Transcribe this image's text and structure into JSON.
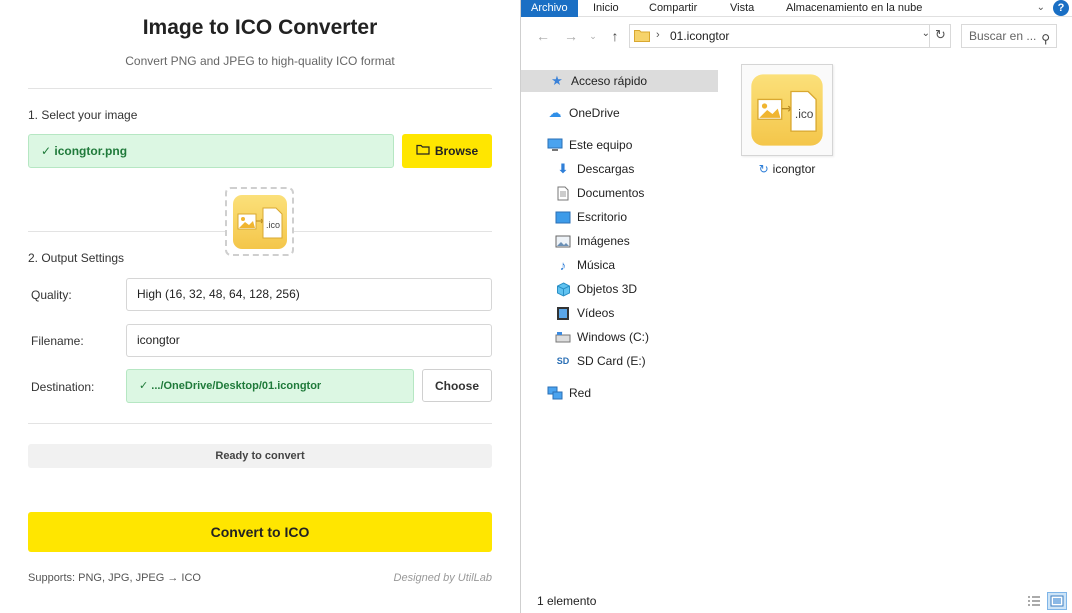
{
  "converter": {
    "title": "Image to ICO Converter",
    "subtitle": "Convert PNG and JPEG to high-quality ICO format",
    "step1_label": "1. Select your image",
    "selected_file": "✓ icongtor.png",
    "browse_label": "Browse",
    "step2_label": "2. Output Settings",
    "quality_label": "Quality:",
    "quality_value": "High (16, 32, 48, 64, 128, 256)",
    "filename_label": "Filename:",
    "filename_value": "icongtor",
    "destination_label": "Destination:",
    "destination_value": "✓ .../OneDrive/Desktop/01.icongtor",
    "choose_label": "Choose",
    "status": "Ready to convert",
    "convert_label": "Convert to ICO",
    "supports": "Supports: PNG, JPG, JPEG → ICO",
    "credit": "Designed by UtilLab",
    "accent_color": "#ffe600",
    "success_color": "#dcf7e3"
  },
  "explorer": {
    "ribbon_tabs": [
      "Archivo",
      "Inicio",
      "Compartir",
      "Vista",
      "Almacenamiento en la nube"
    ],
    "help": "?",
    "address_path": "01.icongtor",
    "search_placeholder": "Buscar en ...",
    "nav_items": [
      {
        "label": "Acceso rápido",
        "icon": "star-icon"
      },
      {
        "label": "OneDrive",
        "icon": "cloud-icon"
      },
      {
        "label": "Este equipo",
        "icon": "computer-icon"
      },
      {
        "label": "Descargas",
        "icon": "download-icon"
      },
      {
        "label": "Documentos",
        "icon": "document-icon"
      },
      {
        "label": "Escritorio",
        "icon": "desktop-icon"
      },
      {
        "label": "Imágenes",
        "icon": "image-icon"
      },
      {
        "label": "Música",
        "icon": "music-icon"
      },
      {
        "label": "Objetos 3D",
        "icon": "cube-icon"
      },
      {
        "label": "Vídeos",
        "icon": "video-icon"
      },
      {
        "label": "Windows (C:)",
        "icon": "drive-icon"
      },
      {
        "label": "SD Card (E:)",
        "icon": "sd-card-icon"
      },
      {
        "label": "Red",
        "icon": "network-icon"
      }
    ],
    "file": {
      "name": "icongtor",
      "thumb_text": ".ico"
    },
    "status_count": "1 elemento",
    "selection_color": "#1a6fc4"
  }
}
